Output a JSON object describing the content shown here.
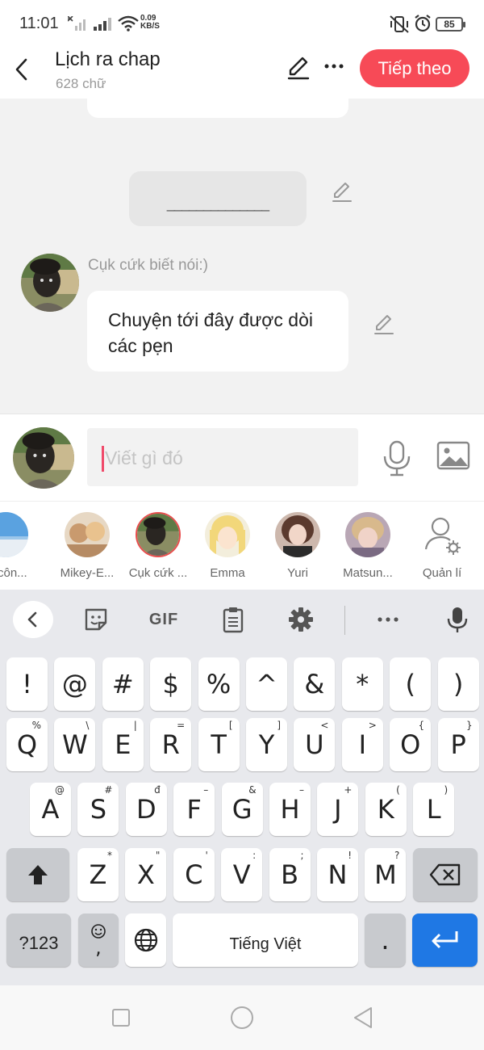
{
  "status_bar": {
    "time": "11:01",
    "net_speed_value": "0.09",
    "net_speed_unit": "KB/S",
    "battery": "85"
  },
  "header": {
    "title": "Lịch ra chap",
    "word_count": "628 chữ",
    "next_label": "Tiếp theo"
  },
  "chat": {
    "divider_text": "______________",
    "sender_name": "Cụk cứk biết nói:)",
    "message": "Chuyện tới đây được dòi các pẹn"
  },
  "input": {
    "placeholder": "Viết gì đó"
  },
  "characters": [
    {
      "label": "... côn..."
    },
    {
      "label": "Mikey-E..."
    },
    {
      "label": "Cụk cứk ..."
    },
    {
      "label": "Emma"
    },
    {
      "label": "Yuri"
    },
    {
      "label": "Matsun..."
    },
    {
      "label": "Quản lí"
    }
  ],
  "keyboard": {
    "gif_label": "GIF",
    "symbols_row": [
      "!",
      "@",
      "#",
      "$",
      "%",
      "^",
      "&",
      "*",
      "(",
      ")"
    ],
    "row1": [
      {
        "key": "Q",
        "hint": "%"
      },
      {
        "key": "W",
        "hint": "\\"
      },
      {
        "key": "E",
        "hint": "|"
      },
      {
        "key": "R",
        "hint": "="
      },
      {
        "key": "T",
        "hint": "["
      },
      {
        "key": "Y",
        "hint": "]"
      },
      {
        "key": "U",
        "hint": "<"
      },
      {
        "key": "I",
        "hint": ">"
      },
      {
        "key": "O",
        "hint": "{"
      },
      {
        "key": "P",
        "hint": "}"
      }
    ],
    "row2": [
      {
        "key": "A",
        "hint": "@"
      },
      {
        "key": "S",
        "hint": "#"
      },
      {
        "key": "D",
        "hint": "đ"
      },
      {
        "key": "F",
        "hint": "–"
      },
      {
        "key": "G",
        "hint": "&"
      },
      {
        "key": "H",
        "hint": "–"
      },
      {
        "key": "J",
        "hint": "+"
      },
      {
        "key": "K",
        "hint": "("
      },
      {
        "key": "L",
        "hint": ")"
      }
    ],
    "row3": [
      {
        "key": "Z",
        "hint": "*"
      },
      {
        "key": "X",
        "hint": "\""
      },
      {
        "key": "C",
        "hint": "'"
      },
      {
        "key": "V",
        "hint": ":"
      },
      {
        "key": "B",
        "hint": ";"
      },
      {
        "key": "N",
        "hint": "!"
      },
      {
        "key": "M",
        "hint": "?"
      }
    ],
    "num_key": "?123",
    "emoji_key": ",",
    "space_label": "Tiếng Việt",
    "period_key": "."
  }
}
